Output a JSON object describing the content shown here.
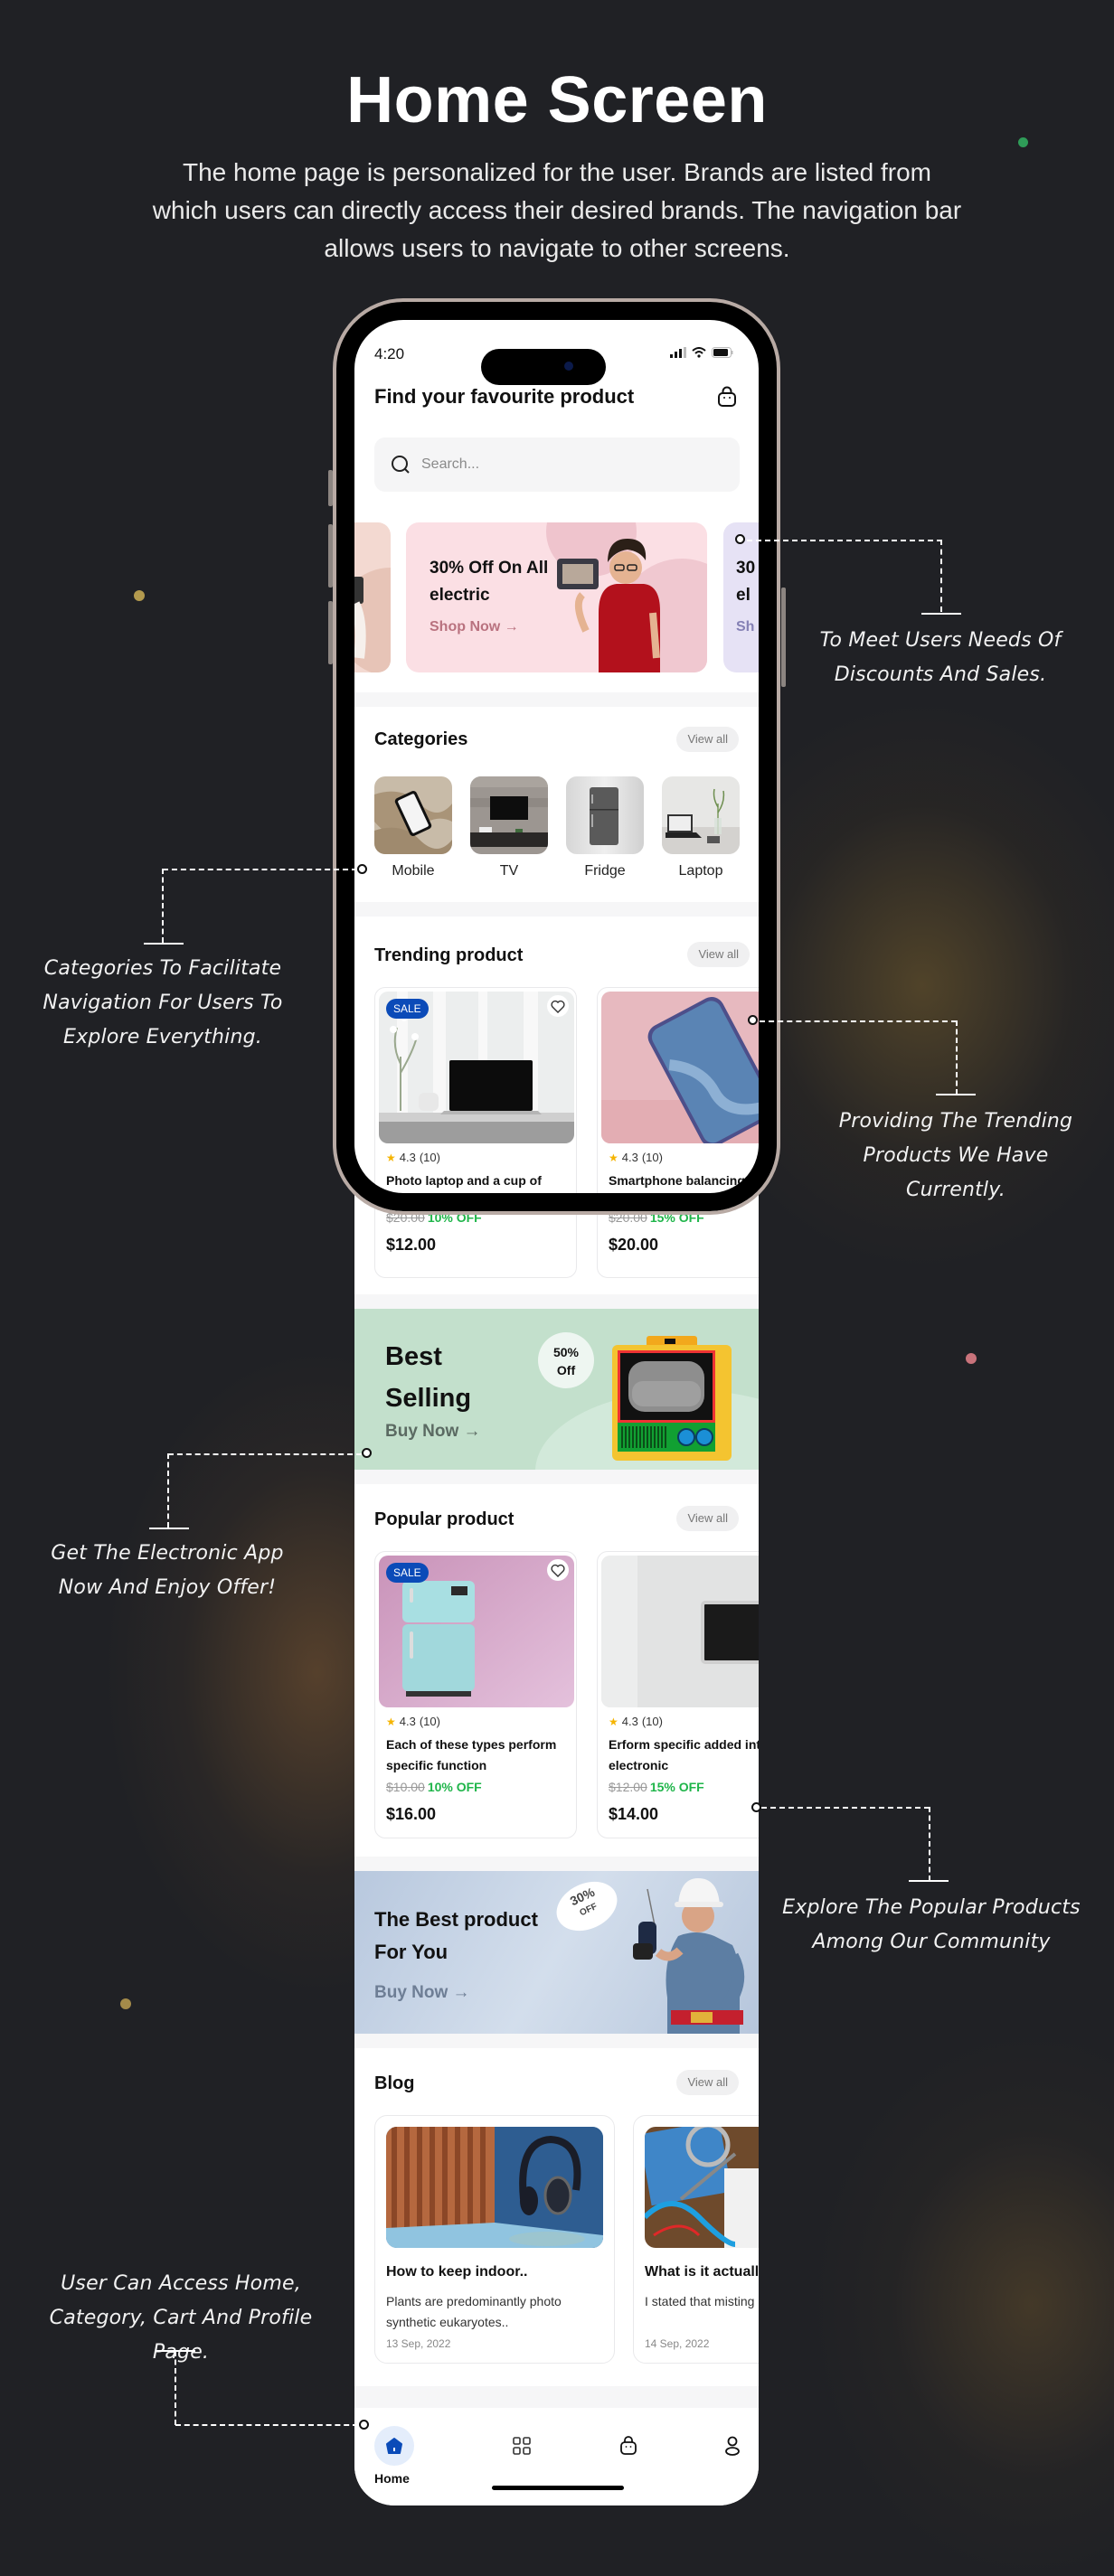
{
  "hero": {
    "title": "Home Screen",
    "description": "The home page is personalized for the user. Brands are listed from which users can directly access their desired brands. The navigation bar allows users to navigate to other screens."
  },
  "status_bar": {
    "time": "4:20"
  },
  "header": {
    "title": "Find your favourite product",
    "cart_icon": "shopping-bag-icon"
  },
  "search": {
    "placeholder": "Search...",
    "value": "",
    "icon": "search-icon"
  },
  "promo_banner": {
    "title": "30% Off On All electric",
    "cta": "Shop Now",
    "cta_arrow": "→",
    "next_card_partial": {
      "line1": "30",
      "line2": "el",
      "cta": "Sh"
    }
  },
  "categories": {
    "title": "Categories",
    "view_all": "View all",
    "items": [
      {
        "label": "Mobile"
      },
      {
        "label": "TV"
      },
      {
        "label": "Fridge"
      },
      {
        "label": "Laptop"
      }
    ]
  },
  "trending": {
    "title": "Trending product",
    "view_all": "View all",
    "products": [
      {
        "badge": "SALE",
        "rating": "4.3",
        "reviews": "(10)",
        "name": "Photo laptop and a cup of",
        "old_price": "$20.00",
        "discount": "10% OFF",
        "price": "$12.00"
      },
      {
        "badge": "",
        "rating": "4.3",
        "reviews": "(10)",
        "name": "Smartphone balancing",
        "old_price": "$20.00",
        "discount": "15% OFF",
        "price": "$20.00"
      }
    ]
  },
  "best_selling": {
    "title_line1": "Best",
    "title_line2": "Selling",
    "bubble_line1": "50%",
    "bubble_line2": "Off",
    "cta": "Buy Now →"
  },
  "popular": {
    "title": "Popular product",
    "view_all": "View all",
    "products": [
      {
        "badge": "SALE",
        "rating": "4.3",
        "reviews": "(10)",
        "name": "Each of these types perform specific function",
        "old_price": "$10.00",
        "discount": "10% OFF",
        "price": "$16.00"
      },
      {
        "badge": "",
        "rating": "4.3",
        "reviews": "(10)",
        "name": "Erform specific added into electronic",
        "old_price": "$12.00",
        "discount": "15% OFF",
        "price": "$14.00"
      }
    ]
  },
  "best_for_you": {
    "title_line1": "The Best product",
    "title_line2": "For You",
    "bubble_line1": "30%",
    "bubble_line2": "OFF",
    "cta": "Buy Now →"
  },
  "blog": {
    "title": "Blog",
    "view_all": "View all",
    "posts": [
      {
        "title": "How to keep indoor..",
        "excerpt": "Plants are predominantly photo synthetic eukaryotes..",
        "date": "13 Sep, 2022"
      },
      {
        "title": "What is it actually",
        "excerpt": " I stated that misting useful to raise humidity",
        "date": "14 Sep, 2022"
      }
    ]
  },
  "nav": {
    "items": [
      {
        "label": "Home",
        "icon": "home-icon",
        "active": true
      },
      {
        "label": "Category",
        "icon": "grid-icon",
        "active": false
      },
      {
        "label": "Cart",
        "icon": "shopping-bag-icon",
        "active": false
      },
      {
        "label": "Profile",
        "icon": "user-icon",
        "active": false
      }
    ]
  },
  "annotations": {
    "discounts": "To Meet Users Needs Of Discounts And Sales.",
    "categories": "Categories To Facilitate Navigation For Users To Explore Everything.",
    "trending": "Providing The Trending Products We Have Currently.",
    "offer": "Get The Electronic App Now And Enjoy Offer!",
    "popular": "Explore The Popular Products Among Our Community",
    "navigation": "User Can Access Home, Category, Cart And Profile Page."
  },
  "colors": {
    "background": "#202125",
    "brand_blue": "#0b4bb8",
    "discount_green": "#1fb54a",
    "promo_pink": "#fbdfe4",
    "best_selling_green": "#c3e0cc",
    "best_for_you_blue": "#bccbe0"
  }
}
